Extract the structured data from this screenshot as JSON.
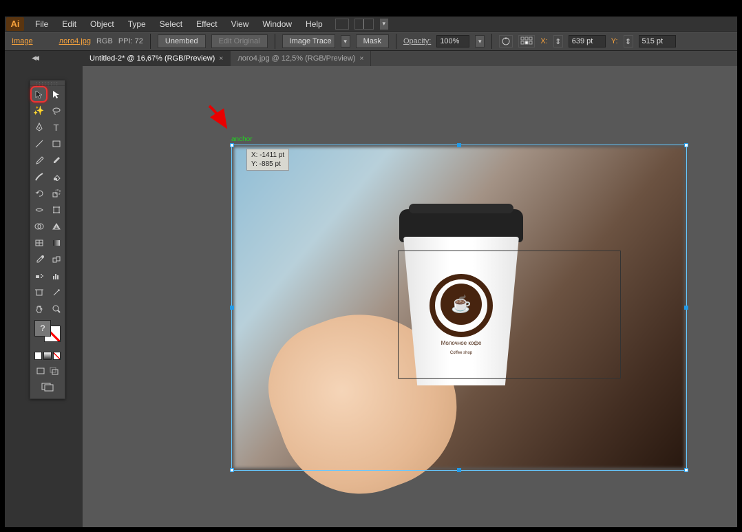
{
  "menu": {
    "items": [
      "File",
      "Edit",
      "Object",
      "Type",
      "Select",
      "Effect",
      "View",
      "Window",
      "Help"
    ]
  },
  "options": {
    "label": "Image",
    "file": "лого4.jpg",
    "color_mode": "RGB",
    "ppi": "PPI: 72",
    "unembed_btn": "Unembed",
    "edit_original_btn": "Edit Original",
    "trace_btn": "Image Trace",
    "mask_btn": "Mask",
    "opacity_label": "Opacity:",
    "opacity_value": "100%",
    "x_label": "X:",
    "x_value": "639 pt",
    "y_label": "Y:",
    "y_value": "515 pt"
  },
  "tabs": [
    {
      "label": "Untitled-2* @ 16,67% (RGB/Preview)",
      "active": true
    },
    {
      "label": "лого4.jpg @ 12,5% (RGB/Preview)",
      "active": false
    }
  ],
  "canvas": {
    "anchor_label": "anchor",
    "tooltip_x": "X: -1411 pt",
    "tooltip_y": "Y: -885 pt",
    "logo_text": "Молочное кофе",
    "logo_sub": "Coffee shop"
  },
  "tools": {
    "swatch_q": "?"
  }
}
